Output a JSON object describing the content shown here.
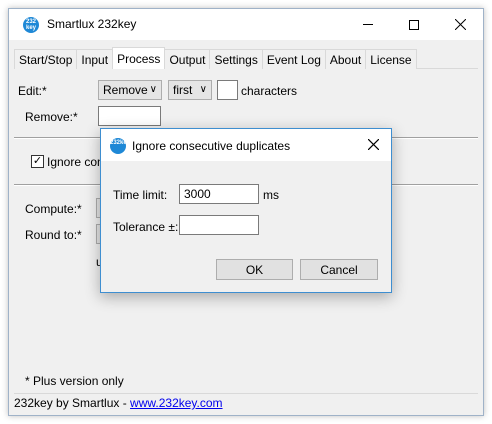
{
  "window": {
    "title": "Smartlux 232key",
    "icon_text_1": "232",
    "icon_text_2": "key"
  },
  "tabs": [
    {
      "label": "Start/Stop"
    },
    {
      "label": "Input"
    },
    {
      "label": "Process",
      "active": true
    },
    {
      "label": "Output"
    },
    {
      "label": "Settings"
    },
    {
      "label": "Event Log"
    },
    {
      "label": "About"
    },
    {
      "label": "License"
    }
  ],
  "process": {
    "edit_label": "Edit:*",
    "edit_action": "Remove",
    "edit_position": "first",
    "edit_count": "",
    "characters_label": "characters",
    "remove_label": "Remove:*",
    "remove_value": "",
    "ignore_label_partial": "Ignore cons",
    "ignore_checked": true,
    "compute_label": "Compute:*",
    "round_label": "Round to:*",
    "hidden_fragment": "u",
    "plus_note": "* Plus version only"
  },
  "status": {
    "prefix": "232key by Smartlux - ",
    "link": "www.232key.com"
  },
  "dialog": {
    "title": "Ignore consecutive duplicates",
    "time_limit_label": "Time limit:",
    "time_limit_value": "3000",
    "time_unit": "ms",
    "tolerance_label": "Tolerance ±:",
    "tolerance_value": "",
    "ok_label": "OK",
    "cancel_label": "Cancel"
  }
}
